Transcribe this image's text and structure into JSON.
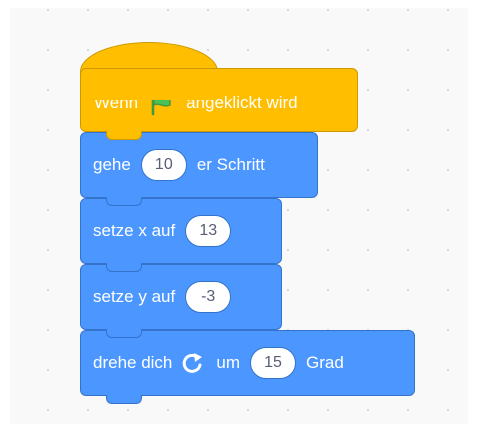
{
  "canvas": {
    "hat": {
      "prefix": "Wenn",
      "icon": "green-flag-icon",
      "suffix": "angeklickt wird",
      "color": "#ffbf00"
    },
    "blocks": [
      {
        "prefix": "gehe",
        "value": "10",
        "suffix": "er Schritt"
      },
      {
        "prefix": "setze x auf",
        "value": "13"
      },
      {
        "prefix": "setze y auf",
        "value": "-3"
      },
      {
        "prefix": "drehe dich",
        "icon": "turn-right-icon",
        "middle": "um",
        "value": "15",
        "suffix": "Grad"
      }
    ],
    "motion_color": "#4c97ff",
    "flag_color": "#4cbf56"
  }
}
